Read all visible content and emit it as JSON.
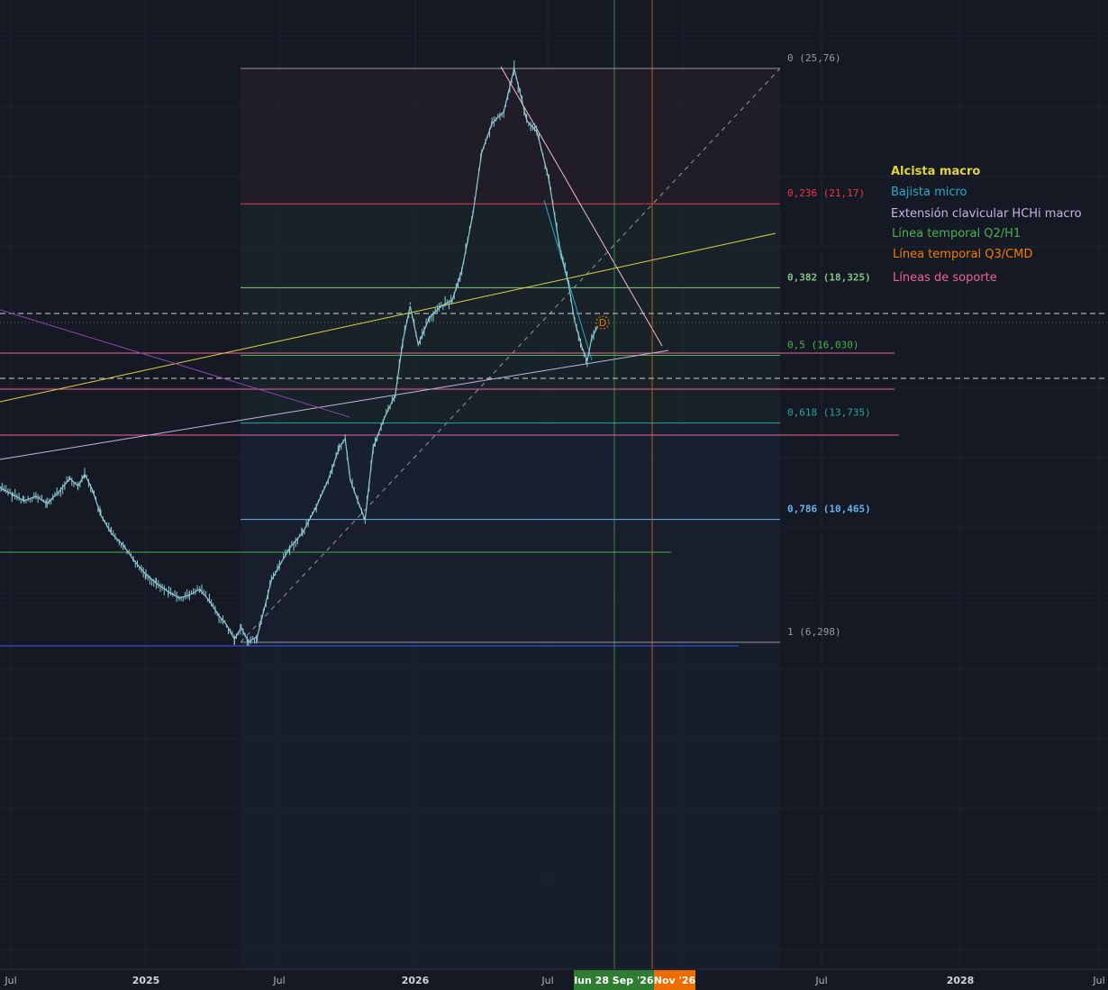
{
  "colors": {
    "background": "#151924",
    "grid": "#1f2433",
    "candle": "#8fc9d4",
    "fib_0": "#9598a1",
    "fib_0236": "#f23645",
    "fib_0382": "#81c784",
    "fib_05": "#4caf50",
    "fib_0618": "#26a69a",
    "fib_0786": "#64b5f6",
    "fib_1": "#9598a1",
    "macro_bull": "#e0d341",
    "micro_bear": "#29a9c9",
    "hchi_ext": "#c9b3e3",
    "temporal_q2": "#4caf50",
    "temporal_q3": "#f57c00",
    "support": "#f06292",
    "x_marker_green": "#2e7d32",
    "x_marker_orange": "#ef6c00"
  },
  "chart_data": {
    "type": "line",
    "title": "",
    "xlabel": "",
    "ylabel": "",
    "ylim": [
      3.0,
      28.5
    ],
    "x_ticks": [
      {
        "label": "Jul",
        "bold": false
      },
      {
        "label": "2025",
        "bold": true
      },
      {
        "label": "Jul",
        "bold": false
      },
      {
        "label": "2026",
        "bold": true
      },
      {
        "label": "Jul",
        "bold": false
      },
      {
        "label": "Jul",
        "bold": false
      },
      {
        "label": "2028",
        "bold": true
      },
      {
        "label": "Jul",
        "bold": false
      }
    ],
    "x_markers": [
      {
        "label": "lun 28 Sep '26",
        "color_key": "x_marker_green"
      },
      {
        "label": "Nov '26",
        "color_key": "x_marker_orange"
      }
    ],
    "fib_levels": [
      {
        "ratio": "0",
        "value": 25.76,
        "label": "0 (25,76)",
        "color_key": "fib_0",
        "bold": false
      },
      {
        "ratio": "0.236",
        "value": 21.17,
        "label": "0,236 (21,17)",
        "color_key": "fib_0236",
        "bold": false
      },
      {
        "ratio": "0.382",
        "value": 18.325,
        "label": "0,382 (18,325)",
        "color_key": "fib_0382",
        "bold": true
      },
      {
        "ratio": "0.5",
        "value": 16.03,
        "label": "0,5 (16,030)",
        "color_key": "fib_05",
        "bold": false
      },
      {
        "ratio": "0.618",
        "value": 13.735,
        "label": "0,618 (13,735)",
        "color_key": "fib_0618",
        "bold": false
      },
      {
        "ratio": "0.786",
        "value": 10.465,
        "label": "0,786 (10,465)",
        "color_key": "fib_0786",
        "bold": true
      },
      {
        "ratio": "1",
        "value": 6.298,
        "label": "1 (6,298)",
        "color_key": "fib_1",
        "bold": false
      }
    ],
    "price_series": [
      [
        "2024-06-05",
        11.9
      ],
      [
        "2024-06-20",
        11.5
      ],
      [
        "2024-07-05",
        11.3
      ],
      [
        "2024-07-20",
        11.1
      ],
      [
        "2024-08-05",
        11.25
      ],
      [
        "2024-08-20",
        11.0
      ],
      [
        "2024-09-05",
        11.4
      ],
      [
        "2024-09-20",
        11.85
      ],
      [
        "2024-10-01",
        11.6
      ],
      [
        "2024-10-10",
        12.0
      ],
      [
        "2024-10-20",
        11.5
      ],
      [
        "2024-11-01",
        10.6
      ],
      [
        "2024-11-15",
        10.0
      ],
      [
        "2024-12-01",
        9.6
      ],
      [
        "2024-12-15",
        9.1
      ],
      [
        "2025-01-01",
        8.6
      ],
      [
        "2025-01-15",
        8.3
      ],
      [
        "2025-02-01",
        8.0
      ],
      [
        "2025-02-15",
        7.8
      ],
      [
        "2025-03-01",
        7.9
      ],
      [
        "2025-03-15",
        8.1
      ],
      [
        "2025-03-28",
        7.7
      ],
      [
        "2025-04-10",
        7.2
      ],
      [
        "2025-04-20",
        6.9
      ],
      [
        "2025-05-01",
        6.4
      ],
      [
        "2025-05-10",
        6.8
      ],
      [
        "2025-05-20",
        6.3
      ],
      [
        "2025-06-01",
        6.5
      ],
      [
        "2025-06-10",
        7.4
      ],
      [
        "2025-06-20",
        8.4
      ],
      [
        "2025-07-01",
        8.9
      ],
      [
        "2025-07-15",
        9.5
      ],
      [
        "2025-08-01",
        10.0
      ],
      [
        "2025-08-20",
        10.9
      ],
      [
        "2025-09-05",
        11.8
      ],
      [
        "2025-09-20",
        12.9
      ],
      [
        "2025-09-28",
        13.2
      ],
      [
        "2025-10-05",
        11.8
      ],
      [
        "2025-10-15",
        11.1
      ],
      [
        "2025-10-25",
        10.45
      ],
      [
        "2025-11-05",
        12.9
      ],
      [
        "2025-11-20",
        13.9
      ],
      [
        "2025-12-05",
        14.7
      ],
      [
        "2025-12-15",
        16.5
      ],
      [
        "2025-12-25",
        17.7
      ],
      [
        "2026-01-05",
        16.4
      ],
      [
        "2026-01-20",
        17.3
      ],
      [
        "2026-02-05",
        17.7
      ],
      [
        "2026-02-20",
        17.9
      ],
      [
        "2026-03-05",
        18.9
      ],
      [
        "2026-03-20",
        20.8
      ],
      [
        "2026-04-01",
        22.9
      ],
      [
        "2026-04-15",
        23.9
      ],
      [
        "2026-05-01",
        24.3
      ],
      [
        "2026-05-15",
        25.76
      ],
      [
        "2026-06-01",
        24.0
      ],
      [
        "2026-06-15",
        23.6
      ],
      [
        "2026-07-01",
        22.0
      ],
      [
        "2026-07-15",
        19.8
      ],
      [
        "2026-07-28",
        18.4
      ],
      [
        "2026-08-05",
        17.2
      ],
      [
        "2026-08-15",
        16.3
      ],
      [
        "2026-08-22",
        15.85
      ],
      [
        "2026-08-28",
        16.6
      ],
      [
        "2026-09-05",
        17.0
      ]
    ]
  },
  "legend": [
    {
      "label": "Alcista macro",
      "color_key": "macro_bull",
      "bold": true
    },
    {
      "label": "Bajista micro",
      "color_key": "micro_bear",
      "bold": false
    },
    {
      "label": "Extensión clavicular HCHi macro",
      "color_key": "hchi_ext",
      "bold": false
    },
    {
      "label": "Línea temporal Q2/H1",
      "color_key": "temporal_q2",
      "bold": false
    },
    {
      "label": "Línea temporal Q3/CMD",
      "color_key": "temporal_q3",
      "bold": false
    },
    {
      "label": "Líneas de soporte",
      "color_key": "support",
      "bold": false
    }
  ],
  "annotation": {
    "label": "D"
  }
}
